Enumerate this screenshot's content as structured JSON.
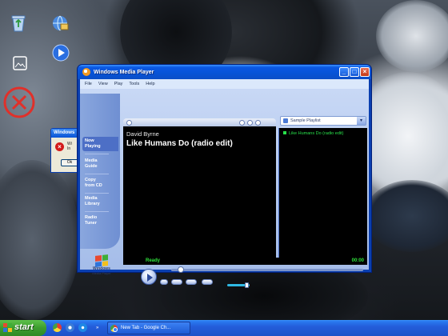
{
  "desktop": {
    "icons": [
      "recycle-bin-icon",
      "network-icon",
      "picture-file-icon",
      "windows-media-player-icon",
      "error-x-icon"
    ]
  },
  "error_dialog": {
    "title": "Windows",
    "message_line1": "Wi",
    "message_line2": "In",
    "ok_label": "Ok"
  },
  "wmp": {
    "title": "Windows Media Player",
    "menu": [
      "File",
      "View",
      "Play",
      "Tools",
      "Help"
    ],
    "side_nav": [
      {
        "label_line1": "Now",
        "label_line2": "Playing"
      },
      {
        "label_line1": "Media",
        "label_line2": "Guide"
      },
      {
        "label_line1": "Copy",
        "label_line2": "from CD"
      },
      {
        "label_line1": "Media",
        "label_line2": "Library"
      },
      {
        "label_line1": "Radio",
        "label_line2": "Tuner"
      }
    ],
    "logo": {
      "line1": "Windows",
      "line2": "Media Player"
    },
    "now_playing": {
      "artist": "David Byrne",
      "track": "Like Humans Do (radio edit)"
    },
    "playlist": {
      "selected": "Sample Playlist",
      "items": [
        "Like Humans Do (radio edit)"
      ]
    },
    "status": {
      "state": "Ready",
      "time": "00:00"
    }
  },
  "taskbar": {
    "start_label": "start",
    "tasks": [
      {
        "label": "New Tab - Google Ch..."
      }
    ]
  },
  "colors": {
    "xp_blue": "#0a3fb0",
    "status_green": "#2fe33b",
    "playlist_green": "#28e04a",
    "start_green": "#3c9c2e"
  }
}
